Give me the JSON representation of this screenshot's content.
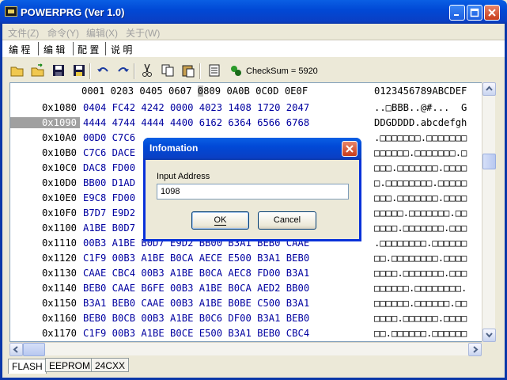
{
  "window": {
    "title": "POWERPRG (Ver 1.0)"
  },
  "menu": {
    "items": [
      "文件(Z)",
      "命令(Y)",
      "编辑(X)",
      "关于(W)"
    ]
  },
  "top_tabs": [
    "编 程",
    "编 辑",
    "配 置",
    "说 明"
  ],
  "toolbar": {
    "icons": [
      "open-folder-icon",
      "open-file-icon",
      "save-icon",
      "save-as-icon",
      "undo-icon",
      "redo-icon",
      "cut-icon",
      "copy-icon",
      "paste-icon",
      "goto-address-icon",
      "checksum-icon"
    ],
    "checksum_label": "CheckSum = 5920"
  },
  "editor": {
    "column_header_pre": "0001 0203 0405 0607 ",
    "column_header_hl": "0",
    "column_header_post": "809 0A0B 0C0D 0E0F",
    "ascii_header": "0123456789ABCDEF",
    "rows": [
      {
        "addr": "0x1080",
        "hex": "0404 FC42 4242 0000 4023 1408 1720 2047",
        "ascii": "..□BBB..@#...  G"
      },
      {
        "addr": "0x1090",
        "hex": "4444 4744 4444 4400 6162 6364 6566 6768",
        "ascii": "DDGDDDD.abcdefgh",
        "selected": true
      },
      {
        "addr": "0x10A0",
        "hex": "00D0 C7C6 ",
        "ascii": ".□□□□□□□.□□□□□□□"
      },
      {
        "addr": "0x10B0",
        "hex": "C7C6 DACE ",
        "ascii": "□□□□□□.□□□□□□□.□"
      },
      {
        "addr": "0x10C0",
        "hex": "DAC8 FD00 ",
        "ascii": "□□□.□□□□□□□.□□□□"
      },
      {
        "addr": "0x10D0",
        "hex": "BB00 D1AD ",
        "ascii": "□.□□□□□□□□.□□□□□"
      },
      {
        "addr": "0x10E0",
        "hex": "E9C8 FD00 ",
        "ascii": "□□□.□□□□□□□.□□□□"
      },
      {
        "addr": "0x10F0",
        "hex": "B7D7 E9D2 ",
        "ascii": "□□□□□.□□□□□□□.□□"
      },
      {
        "addr": "0x1100",
        "hex": "A1BE B0D7 ",
        "ascii": "□□□□.□□□□□□□.□□□"
      },
      {
        "addr": "0x1110",
        "hex": "00B3 A1BE B0D7 E9D2 BB00 B3A1 BEB0 CAAE",
        "ascii": ".□□□□□□□□.□□□□□□"
      },
      {
        "addr": "0x1120",
        "hex": "C1F9 00B3 A1BE B0CA AECE E500 B3A1 BEB0",
        "ascii": "□□.□□□□□□□□.□□□□"
      },
      {
        "addr": "0x1130",
        "hex": "CAAE CBC4 00B3 A1BE B0CA AEC8 FD00 B3A1",
        "ascii": "□□□□.□□□□□□□.□□□"
      },
      {
        "addr": "0x1140",
        "hex": "BEB0 CAAE B6FE 00B3 A1BE B0CA AED2 BB00",
        "ascii": "□□□□□□.□□□□□□□□."
      },
      {
        "addr": "0x1150",
        "hex": "B3A1 BEB0 CAAE 00B3 A1BE B0BE C500 B3A1",
        "ascii": "□□□□□□.□□□□□□.□□"
      },
      {
        "addr": "0x1160",
        "hex": "BEB0 B0CB 00B3 A1BE B0C6 DF00 B3A1 BEB0",
        "ascii": "□□□□.□□□□□□.□□□□"
      },
      {
        "addr": "0x1170",
        "hex": "C1F9 00B3 A1BE B0CE E500 B3A1 BEB0 CBC4",
        "ascii": "□□.□□□□□□.□□□□□□"
      }
    ]
  },
  "bottom_tabs": [
    "FLASH",
    "EEPROM",
    "24CXX"
  ],
  "dialog": {
    "title": "Infomation",
    "label": "Input Address",
    "input_value": "1098",
    "ok_label": "OK",
    "cancel_label": "Cancel"
  }
}
